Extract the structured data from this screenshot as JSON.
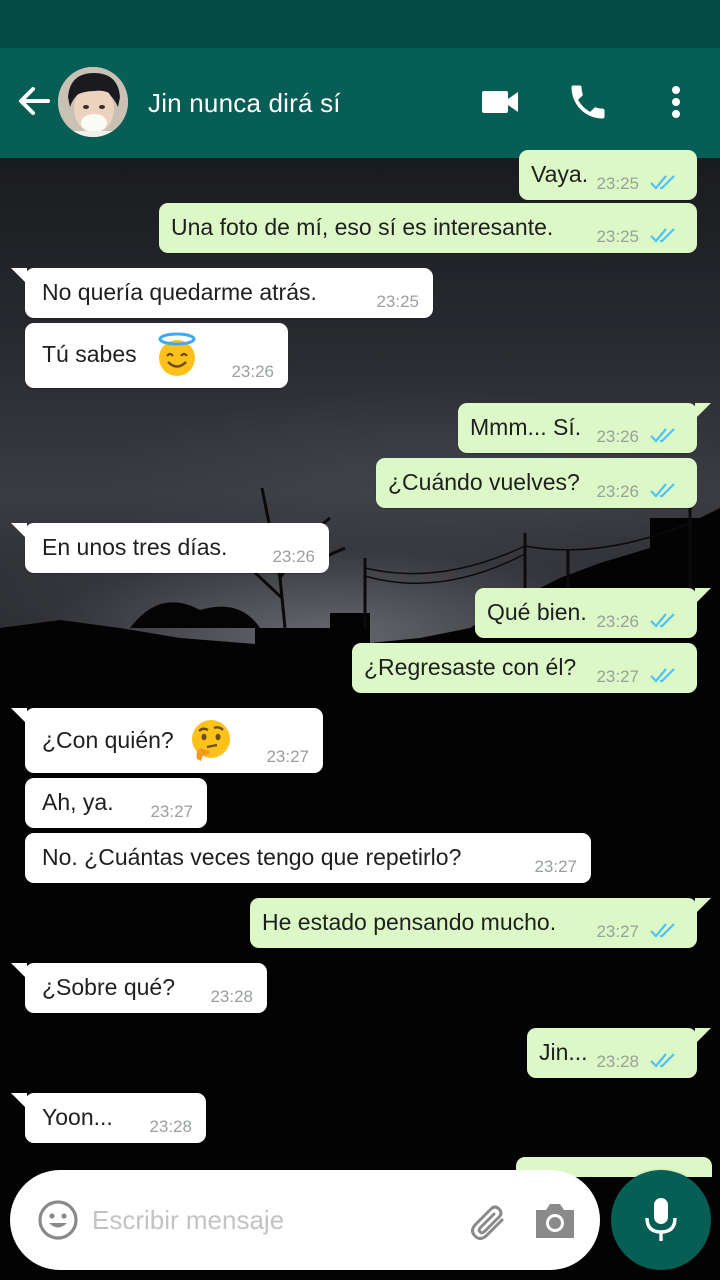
{
  "header": {
    "contact_name": "Jin nunca dirá sí",
    "icons": {
      "back": "arrow-left-icon",
      "video": "videocam-icon",
      "call": "phone-icon",
      "menu": "more-vert-icon"
    }
  },
  "messages": [
    {
      "dir": "out",
      "text": "Vaya.",
      "time": "23:25",
      "read": true
    },
    {
      "dir": "out",
      "text": "Una foto de mí, eso sí es interesante.",
      "time": "23:25",
      "read": true
    },
    {
      "dir": "in",
      "text": "No quería quedarme atrás.",
      "time": "23:25"
    },
    {
      "dir": "in",
      "text": "Tú sabes",
      "emoji": "smiling-face-with-halo",
      "time": "23:26"
    },
    {
      "dir": "out",
      "text": "Mmm... Sí.",
      "time": "23:26",
      "read": true
    },
    {
      "dir": "out",
      "text": "¿Cuándo vuelves?",
      "time": "23:26",
      "read": true
    },
    {
      "dir": "in",
      "text": "En unos tres días.",
      "time": "23:26"
    },
    {
      "dir": "out",
      "text": "Qué bien.",
      "time": "23:26",
      "read": true
    },
    {
      "dir": "out",
      "text": "¿Regresaste con él?",
      "time": "23:27",
      "read": true
    },
    {
      "dir": "in",
      "text": "¿Con quién?",
      "emoji": "thinking-face",
      "time": "23:27"
    },
    {
      "dir": "in",
      "text": "Ah, ya.",
      "time": "23:27"
    },
    {
      "dir": "in",
      "text": "No. ¿Cuántas veces tengo que repetirlo?",
      "time": "23:27"
    },
    {
      "dir": "out",
      "text": "He estado pensando mucho.",
      "time": "23:27",
      "read": true
    },
    {
      "dir": "in",
      "text": "¿Sobre qué?",
      "time": "23:28"
    },
    {
      "dir": "out",
      "text": "Jin...",
      "time": "23:28",
      "read": true
    },
    {
      "dir": "in",
      "text": "Yoon...",
      "time": "23:28"
    }
  ],
  "input": {
    "placeholder": "Escribir mensaje",
    "icons": {
      "emoji": "emoji-face-icon",
      "attach": "paperclip-icon",
      "camera": "camera-icon",
      "mic": "microphone-icon"
    }
  },
  "colors": {
    "header": "#075e54",
    "status_bar": "#054d44",
    "outgoing_bubble": "#dcf8c6",
    "incoming_bubble": "#ffffff",
    "read_ticks": "#4fc3f7"
  }
}
